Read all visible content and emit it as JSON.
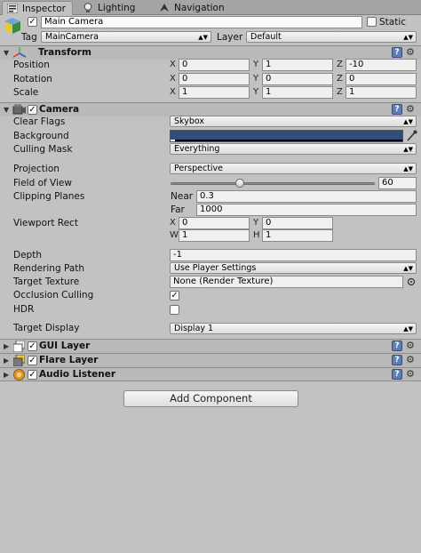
{
  "tabs": [
    {
      "label": "Inspector",
      "icon": "info-icon",
      "active": true
    },
    {
      "label": "Lighting",
      "icon": "lightbulb-icon",
      "active": false
    },
    {
      "label": "Navigation",
      "icon": "navigation-icon",
      "active": false
    }
  ],
  "object": {
    "name": "Main Camera",
    "active": true,
    "static_label": "Static",
    "static": false,
    "tag_label": "Tag",
    "tag_value": "MainCamera",
    "layer_label": "Layer",
    "layer_value": "Default"
  },
  "transform": {
    "title": "Transform",
    "rows": [
      {
        "label": "Position",
        "x": "0",
        "y": "1",
        "z": "-10"
      },
      {
        "label": "Rotation",
        "x": "0",
        "y": "0",
        "z": "0"
      },
      {
        "label": "Scale",
        "x": "1",
        "y": "1",
        "z": "1"
      }
    ],
    "axes": {
      "x": "X",
      "y": "Y",
      "z": "Z"
    }
  },
  "camera": {
    "title": "Camera",
    "enabled": true,
    "clear_flags_label": "Clear Flags",
    "clear_flags_value": "Skybox",
    "background_label": "Background",
    "background_color": "#314d79",
    "culling_mask_label": "Culling Mask",
    "culling_mask_value": "Everything",
    "projection_label": "Projection",
    "projection_value": "Perspective",
    "fov_label": "Field of View",
    "fov_value": "60",
    "fov_fraction": 0.33,
    "clipping_label": "Clipping Planes",
    "near_label": "Near",
    "near_value": "0.3",
    "far_label": "Far",
    "far_value": "1000",
    "viewport_label": "Viewport Rect",
    "vp_x_label": "X",
    "vp_x": "0",
    "vp_y_label": "Y",
    "vp_y": "0",
    "vp_w_label": "W",
    "vp_w": "1",
    "vp_h_label": "H",
    "vp_h": "1",
    "depth_label": "Depth",
    "depth_value": "-1",
    "rendering_path_label": "Rendering Path",
    "rendering_path_value": "Use Player Settings",
    "target_texture_label": "Target Texture",
    "target_texture_value": "None (Render Texture)",
    "occlusion_label": "Occlusion Culling",
    "occlusion": true,
    "hdr_label": "HDR",
    "hdr": false,
    "target_display_label": "Target Display",
    "target_display_value": "Display 1"
  },
  "components": [
    {
      "title": "GUI Layer",
      "enabled": true
    },
    {
      "title": "Flare Layer",
      "enabled": true
    },
    {
      "title": "Audio Listener",
      "enabled": true
    }
  ],
  "help_glyph": "?",
  "add_component_label": "Add Component"
}
